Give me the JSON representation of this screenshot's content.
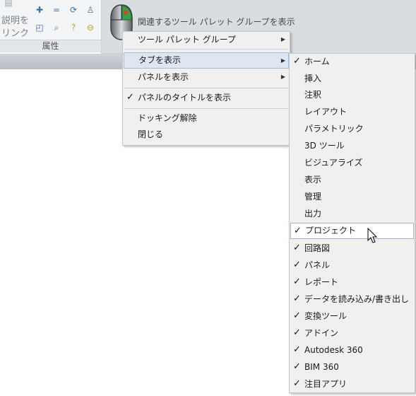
{
  "ribbon": {
    "panel_text_1": "説明を",
    "panel_text_2": "リンク",
    "panel_title": "属性"
  },
  "context_menu": {
    "header": "関連するツール パレット グループを表示",
    "items": [
      {
        "label": "ツール パレット グループ",
        "submenu": true
      },
      {
        "label": "タブを表示",
        "submenu": true
      },
      {
        "label": "パネルを表示",
        "submenu": true
      },
      {
        "label": "パネルのタイトルを表示",
        "checked": true
      },
      {
        "label": "ドッキング解除"
      },
      {
        "label": "閉じる"
      }
    ]
  },
  "tabs_submenu": {
    "items": [
      {
        "label": "ホーム",
        "checked": true
      },
      {
        "label": "挿入",
        "checked": false
      },
      {
        "label": "注釈",
        "checked": false
      },
      {
        "label": "レイアウト",
        "checked": false
      },
      {
        "label": "パラメトリック",
        "checked": false
      },
      {
        "label": "3D ツール",
        "checked": false
      },
      {
        "label": "ビジュアライズ",
        "checked": false
      },
      {
        "label": "表示",
        "checked": false
      },
      {
        "label": "管理",
        "checked": false
      },
      {
        "label": "出力",
        "checked": false
      },
      {
        "label": "プロジェクト",
        "checked": true
      },
      {
        "label": "回路図",
        "checked": true
      },
      {
        "label": "パネル",
        "checked": true
      },
      {
        "label": "レポート",
        "checked": true
      },
      {
        "label": "データを読み込み/書き出し",
        "checked": true
      },
      {
        "label": "変換ツール",
        "checked": true
      },
      {
        "label": "アドイン",
        "checked": true
      },
      {
        "label": "Autodesk 360",
        "checked": true
      },
      {
        "label": "BIM 360",
        "checked": true
      },
      {
        "label": "注目アプリ",
        "checked": true
      }
    ]
  },
  "colors": {
    "menu_bg": "#f0f0f0",
    "highlight": "#dde6f1"
  }
}
